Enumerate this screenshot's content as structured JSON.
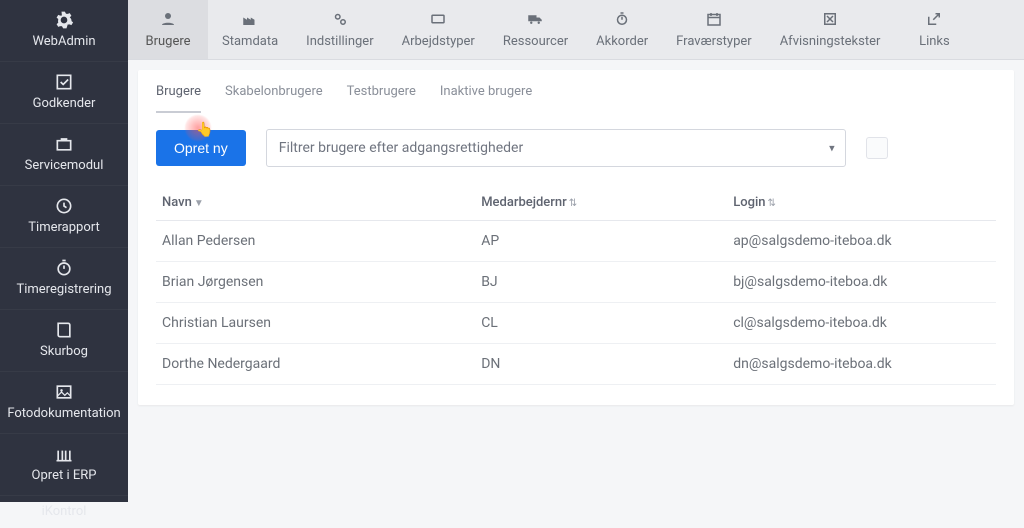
{
  "sidebar": {
    "items": [
      {
        "label": "WebAdmin",
        "icon": "gear-icon"
      },
      {
        "label": "Godkender",
        "icon": "check-square-icon"
      },
      {
        "label": "Servicemodul",
        "icon": "briefcase-icon"
      },
      {
        "label": "Timerapport",
        "icon": "clock-icon"
      },
      {
        "label": "Timeregistrering",
        "icon": "stopwatch-icon"
      },
      {
        "label": "Skurbog",
        "icon": "book-icon"
      },
      {
        "label": "Fotodokumentation",
        "icon": "image-icon"
      },
      {
        "label": "Opret i ERP",
        "icon": "library-icon"
      },
      {
        "label": "iKontrol",
        "icon": ""
      }
    ]
  },
  "topnav": {
    "items": [
      {
        "label": "Brugere",
        "icon": "user-icon",
        "active": true
      },
      {
        "label": "Stamdata",
        "icon": "factory-icon"
      },
      {
        "label": "Indstillinger",
        "icon": "gears-icon"
      },
      {
        "label": "Arbejdstyper",
        "icon": "card-icon"
      },
      {
        "label": "Ressourcer",
        "icon": "truck-icon"
      },
      {
        "label": "Akkorder",
        "icon": "stopwatch-icon"
      },
      {
        "label": "Fraværstyper",
        "icon": "calendar-icon"
      },
      {
        "label": "Afvisningstekster",
        "icon": "reject-icon"
      },
      {
        "label": "Links",
        "icon": "external-icon"
      }
    ]
  },
  "tabs": {
    "items": [
      "Brugere",
      "Skabelonbrugere",
      "Testbrugere",
      "Inaktive brugere"
    ],
    "active": 0
  },
  "toolbar": {
    "create_label": "Opret ny",
    "filter_placeholder": "Filtrer brugere efter adgangsrettigheder"
  },
  "table": {
    "headers": {
      "name": "Navn",
      "emp": "Medarbejdernr",
      "login": "Login"
    },
    "rows": [
      {
        "name": "Allan Pedersen",
        "emp": "AP",
        "login": "ap@salgsdemo-iteboa.dk"
      },
      {
        "name": "Brian Jørgensen",
        "emp": "BJ",
        "login": "bj@salgsdemo-iteboa.dk"
      },
      {
        "name": "Christian Laursen",
        "emp": "CL",
        "login": "cl@salgsdemo-iteboa.dk"
      },
      {
        "name": "Dorthe Nedergaard",
        "emp": "DN",
        "login": "dn@salgsdemo-iteboa.dk"
      }
    ]
  }
}
